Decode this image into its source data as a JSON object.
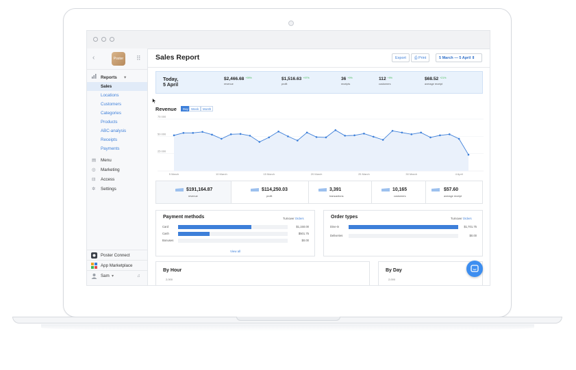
{
  "window": {
    "traffic_lights": [
      "close",
      "minimize",
      "maximize"
    ]
  },
  "sidebar": {
    "back_icon": "chevron-left-icon",
    "logo_text": "Poster",
    "grid_icon": "grid-icon",
    "sections": [
      {
        "label": "Reports",
        "icon": "bar-chart-icon",
        "items": [
          "Sales",
          "Locations",
          "Customers",
          "Categories",
          "Products",
          "ABC-analysis",
          "Receipts",
          "Payments"
        ],
        "active": "Sales"
      },
      {
        "label": "Menu",
        "icon": "book-icon"
      },
      {
        "label": "Marketing",
        "icon": "target-icon"
      },
      {
        "label": "Access",
        "icon": "lock-icon"
      },
      {
        "label": "Settings",
        "icon": "gear-icon"
      }
    ],
    "bottom": {
      "connect": "Poster Connect",
      "marketplace": "App Marketplace",
      "user": "Sam"
    }
  },
  "header": {
    "title": "Sales Report",
    "export": "Export",
    "print": "Print",
    "date_range": "5 March — 5 April"
  },
  "summary": {
    "today": "Today,",
    "date": "5 April",
    "items": [
      {
        "value": "$2,466.68",
        "pct": "+99%",
        "label": "revenue"
      },
      {
        "value": "$1,516.63",
        "pct": "+97%",
        "label": "profit"
      },
      {
        "value": "36",
        "pct": "+9%",
        "label": "receipts"
      },
      {
        "value": "112",
        "pct": "+9%",
        "label": "customers"
      },
      {
        "value": "$68.52",
        "pct": "+21%",
        "label": "average receipt"
      }
    ]
  },
  "revenue": {
    "title": "Revenue",
    "tabs": [
      "Day",
      "Week",
      "Month"
    ],
    "active_tab": "Day"
  },
  "chart_data": {
    "type": "area",
    "title": "Revenue",
    "y_ticks": [
      "75 000",
      "50 000",
      "25 000"
    ],
    "x_ticks": [
      "5 March",
      "10 March",
      "15 March",
      "20 March",
      "25 March",
      "30 March",
      "4 April"
    ],
    "ylim": [
      0,
      80000
    ],
    "x": [
      "5 March",
      "6 March",
      "7 March",
      "8 March",
      "9 March",
      "10 March",
      "11 March",
      "12 March",
      "13 March",
      "14 March",
      "15 March",
      "16 March",
      "17 March",
      "18 March",
      "19 March",
      "20 March",
      "21 March",
      "22 March",
      "23 March",
      "24 March",
      "25 March",
      "26 March",
      "27 March",
      "28 March",
      "29 March",
      "30 March",
      "31 March",
      "1 April",
      "2 April",
      "3 April",
      "4 April",
      "5 April"
    ],
    "values": [
      51500,
      55000,
      55000,
      56500,
      52500,
      46500,
      53000,
      53500,
      51000,
      42000,
      48500,
      57000,
      50000,
      44000,
      55500,
      49000,
      48500,
      59000,
      51000,
      51500,
      54000,
      49500,
      45000,
      58000,
      55500,
      53000,
      55500,
      48500,
      51500,
      53000,
      46500,
      23500
    ],
    "grid": true,
    "color": "#3d7fd9",
    "fill": "#eaf1fb"
  },
  "stats": [
    {
      "value": "$191,164.87",
      "label": "revenue"
    },
    {
      "value": "$114,250.03",
      "label": "profit"
    },
    {
      "value": "3,391",
      "label": "transactions"
    },
    {
      "value": "10,165",
      "label": "customers"
    },
    {
      "value": "$57.60",
      "label": "average receipt"
    }
  ],
  "payment_methods": {
    "title": "Payment methods",
    "link_turnover": "Turnover",
    "link_orders": "Orders",
    "rows": [
      {
        "label": "Card",
        "value": "$1,150.00",
        "fraction": 0.67
      },
      {
        "label": "Cash",
        "value": "$501.75",
        "fraction": 0.29
      },
      {
        "label": "Bonuses",
        "value": "$0.00",
        "fraction": 0
      }
    ],
    "view_all": "View all"
  },
  "order_types": {
    "title": "Order types",
    "link_turnover": "Turnover",
    "link_orders": "Orders",
    "rows": [
      {
        "label": "Dine-in",
        "value": "$1,701.75",
        "fraction": 1.0
      },
      {
        "label": "Deliveries",
        "value": "$0.00",
        "fraction": 0
      }
    ]
  },
  "by_hour": {
    "title": "By Hour",
    "tick": "2,000"
  },
  "by_day": {
    "title": "By Day",
    "tick": "2,000"
  },
  "colors": {
    "accent": "#3d7fd9",
    "positive": "#3fb950",
    "summary_bg": "#e9f2fc"
  }
}
